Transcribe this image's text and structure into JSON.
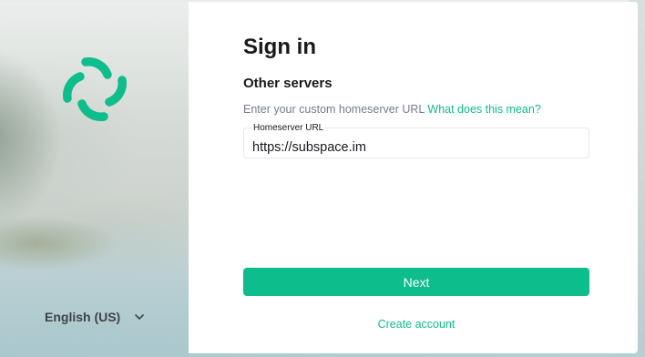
{
  "colors": {
    "accent": "#0dbd8b",
    "text_primary": "#17191c",
    "text_secondary": "#737d8c"
  },
  "left_panel": {
    "logo_icon": "element-logo-icon",
    "language": {
      "label": "English (US)",
      "icon": "chevron-down-icon"
    }
  },
  "form": {
    "title": "Sign in",
    "subtitle": "Other servers",
    "hint_text": "Enter your custom homeserver URL",
    "hint_link": "What does this mean?",
    "homeserver_field": {
      "label": "Homeserver URL",
      "value": "https://subspace.im"
    },
    "next_label": "Next",
    "create_account_label": "Create account"
  }
}
